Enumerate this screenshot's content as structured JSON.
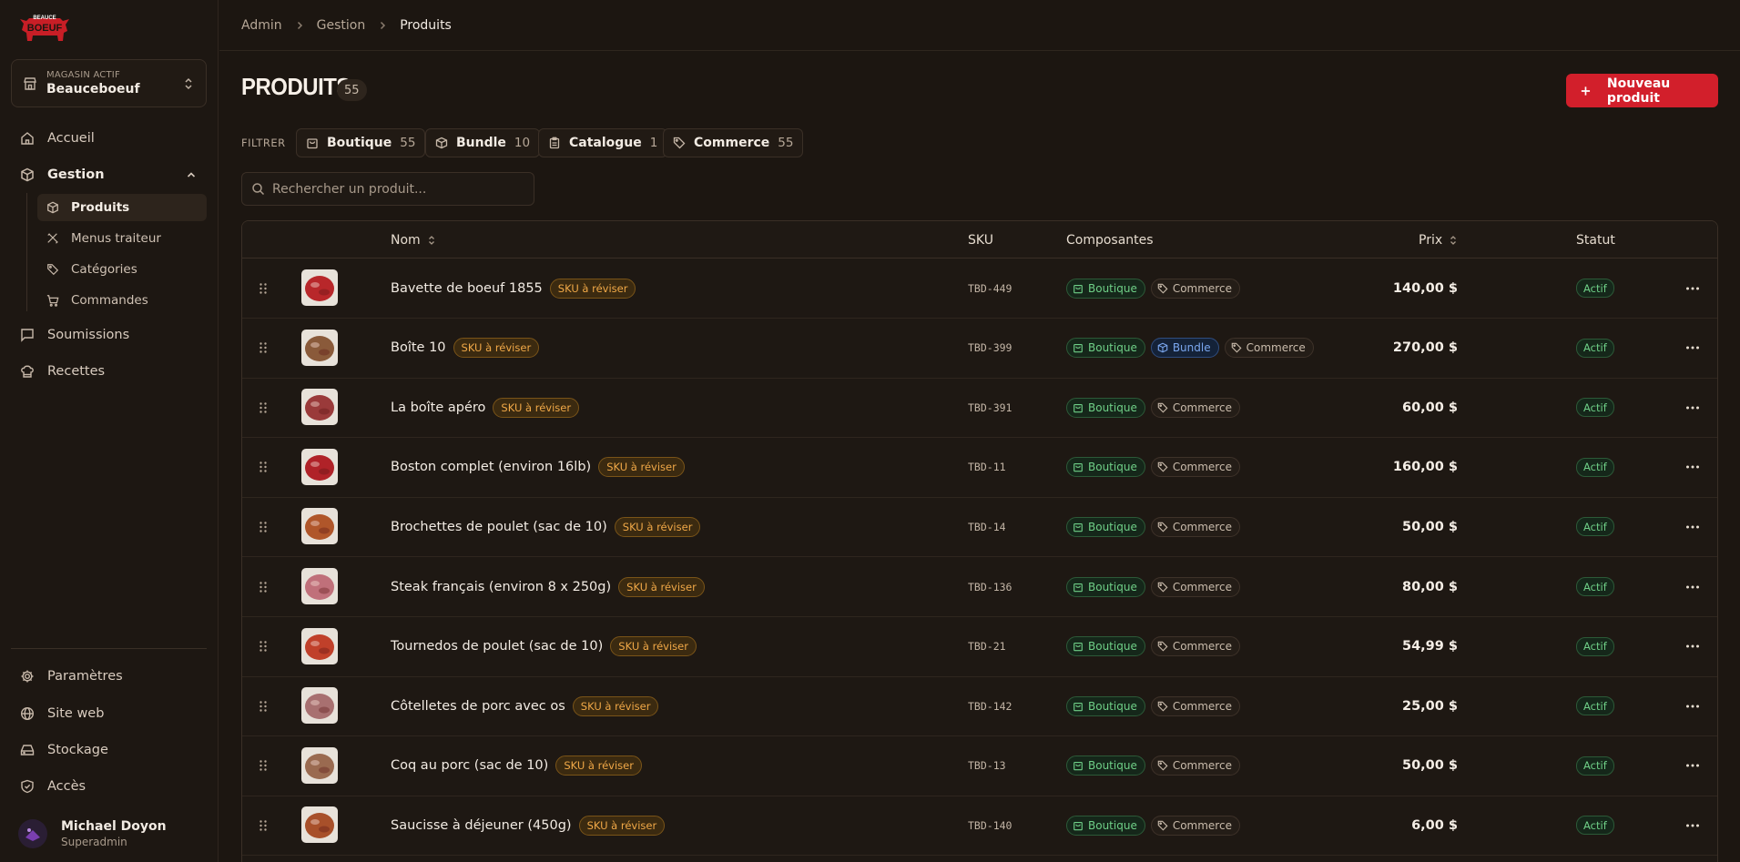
{
  "brand": {
    "logo_alt": "Beauceboeuf",
    "logo_top_text": "BEAUCE",
    "logo_bottom_text": "BOEUF"
  },
  "store": {
    "label": "MAGASIN ACTIF",
    "name": "Beauceboeuf"
  },
  "nav": {
    "accueil": "Accueil",
    "gestion": "Gestion",
    "sub": {
      "produits": "Produits",
      "menus": "Menus traiteur",
      "categories": "Catégories",
      "commandes": "Commandes"
    },
    "soumissions": "Soumissions",
    "recettes": "Recettes",
    "parametres": "Paramètres",
    "site_web": "Site web",
    "stockage": "Stockage",
    "acces": "Accès"
  },
  "user": {
    "name": "Michael Doyon",
    "role": "Superadmin"
  },
  "breadcrumb": [
    "Admin",
    "Gestion",
    "Produits"
  ],
  "header": {
    "title": "PRODUITS",
    "count": "55",
    "new_button": "Nouveau produit"
  },
  "filters": {
    "label": "FILTRER",
    "chips": [
      {
        "label": "Boutique",
        "count": "55",
        "icon": "bag-icon"
      },
      {
        "label": "Bundle",
        "count": "10",
        "icon": "box-icon"
      },
      {
        "label": "Catalogue",
        "count": "1",
        "icon": "clipboard-icon"
      },
      {
        "label": "Commerce",
        "count": "55",
        "icon": "tag-icon"
      }
    ]
  },
  "search": {
    "placeholder": "Rechercher un produit...",
    "value": ""
  },
  "table": {
    "headers": {
      "nom": "Nom",
      "sku": "SKU",
      "composantes": "Composantes",
      "prix": "Prix",
      "statut": "Statut"
    },
    "warn_badge": "SKU à réviser",
    "status_label": "Actif",
    "tag_labels": {
      "boutique": "Boutique",
      "bundle": "Bundle",
      "commerce": "Commerce"
    },
    "rows": [
      {
        "name": "Bavette de boeuf 1855",
        "sku": "TBD-449",
        "price": "140,00 $",
        "bundle": false,
        "thumb": "#b8272a"
      },
      {
        "name": "Boîte 10",
        "sku": "TBD-399",
        "price": "270,00 $",
        "bundle": true,
        "thumb": "#8a5a3a"
      },
      {
        "name": "La boîte apéro",
        "sku": "TBD-391",
        "price": "60,00 $",
        "bundle": false,
        "thumb": "#9a3a3a"
      },
      {
        "name": "Boston complet (environ 16lb)",
        "sku": "TBD-11",
        "price": "160,00 $",
        "bundle": false,
        "thumb": "#b02228"
      },
      {
        "name": "Brochettes de poulet (sac de 10)",
        "sku": "TBD-14",
        "price": "50,00 $",
        "bundle": false,
        "thumb": "#b0562a"
      },
      {
        "name": "Steak français (environ 8 x 250g)",
        "sku": "TBD-136",
        "price": "80,00 $",
        "bundle": false,
        "thumb": "#c0707a"
      },
      {
        "name": "Tournedos de poulet (sac de 10)",
        "sku": "TBD-21",
        "price": "54,99 $",
        "bundle": false,
        "thumb": "#c0402a"
      },
      {
        "name": "Côtelletes de porc avec os",
        "sku": "TBD-142",
        "price": "25,00 $",
        "bundle": false,
        "thumb": "#a87070"
      },
      {
        "name": "Coq au porc (sac de 10)",
        "sku": "TBD-13",
        "price": "50,00 $",
        "bundle": false,
        "thumb": "#9a6a50"
      },
      {
        "name": "Saucisse à déjeuner (450g)",
        "sku": "TBD-140",
        "price": "6,00 $",
        "bundle": false,
        "thumb": "#a8502a"
      }
    ]
  },
  "colors": {
    "background": "#1c1611",
    "accent": "#d21f2b",
    "warn": "#f0a847",
    "success": "#6fcf87",
    "info": "#7aa6ee"
  }
}
